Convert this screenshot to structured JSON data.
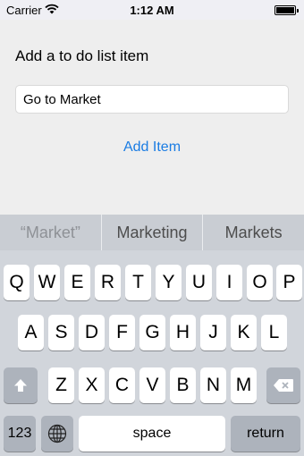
{
  "status_bar": {
    "carrier": "Carrier",
    "time": "1:12 AM",
    "battery_level": 1.0
  },
  "main": {
    "prompt": "Add a to do list item",
    "input_value": "Go to Market",
    "add_button_label": "Add Item",
    "accent_color": "#1a7ce3"
  },
  "keyboard": {
    "suggestions": [
      "“Market”",
      "Marketing",
      "Markets"
    ],
    "row1": [
      "Q",
      "W",
      "E",
      "R",
      "T",
      "Y",
      "U",
      "I",
      "O",
      "P"
    ],
    "row2": [
      "A",
      "S",
      "D",
      "F",
      "G",
      "H",
      "J",
      "K",
      "L"
    ],
    "row3": [
      "Z",
      "X",
      "C",
      "V",
      "B",
      "N",
      "M"
    ],
    "numbers_key": "123",
    "space_key": "space",
    "return_key": "return",
    "icons": [
      "shift-icon",
      "delete-icon",
      "globe-icon",
      "wifi-icon"
    ]
  }
}
